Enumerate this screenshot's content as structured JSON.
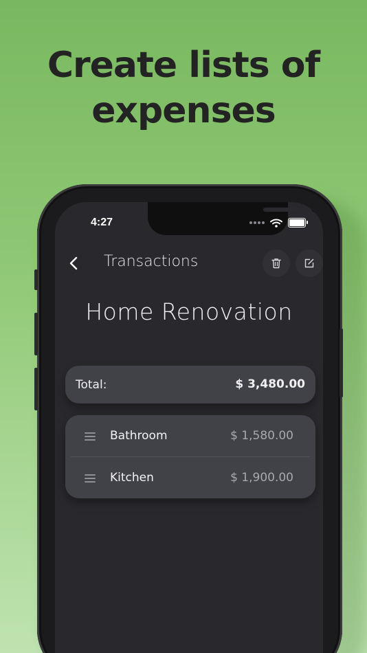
{
  "headline": {
    "line1": "Create lists of",
    "line2": "expenses"
  },
  "status_bar": {
    "time": "4:27"
  },
  "nav": {
    "title": "Transactions"
  },
  "list": {
    "title": "Home Renovation",
    "total_label": "Total:",
    "total_value": "$ 3,480.00",
    "items": [
      {
        "name": "Bathroom",
        "amount": "$ 1,580.00"
      },
      {
        "name": "Kitchen",
        "amount": "$ 1,900.00"
      }
    ]
  },
  "icons": {
    "back": "chevron-left-icon",
    "delete": "trash-icon",
    "edit": "edit-icon",
    "drag": "drag-handle-icon",
    "wifi": "wifi-icon",
    "battery": "battery-icon",
    "signal": "signal-dots-icon"
  },
  "colors": {
    "background_top": "#79b860",
    "background_bottom": "#bfe3b0",
    "screen": "#29292d",
    "card": "#414148",
    "headline": "#232323"
  }
}
